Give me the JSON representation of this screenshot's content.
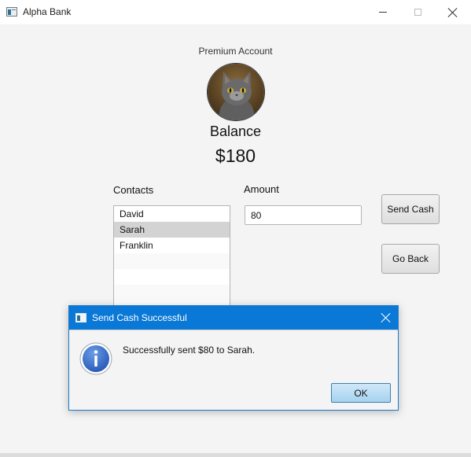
{
  "window": {
    "title": "Alpha Bank",
    "icon": "app-window-icon"
  },
  "account": {
    "type_label": "Premium Account",
    "avatar": "cat-photo",
    "balance_label": "Balance",
    "balance_value": "$180"
  },
  "contacts": {
    "label": "Contacts",
    "items": [
      {
        "name": "David",
        "selected": false
      },
      {
        "name": "Sarah",
        "selected": true
      },
      {
        "name": "Franklin",
        "selected": false
      }
    ]
  },
  "amount": {
    "label": "Amount",
    "value": "80"
  },
  "buttons": {
    "send": "Send Cash",
    "back": "Go Back"
  },
  "dialog": {
    "title": "Send Cash Successful",
    "icon": "info-icon",
    "message": "Successfully sent $80 to Sarah.",
    "ok_label": "OK"
  },
  "colors": {
    "dialog_title_bar": "#0a78d7",
    "info_icon": "#3a6fc9",
    "ok_button": "#a6d2ef"
  }
}
